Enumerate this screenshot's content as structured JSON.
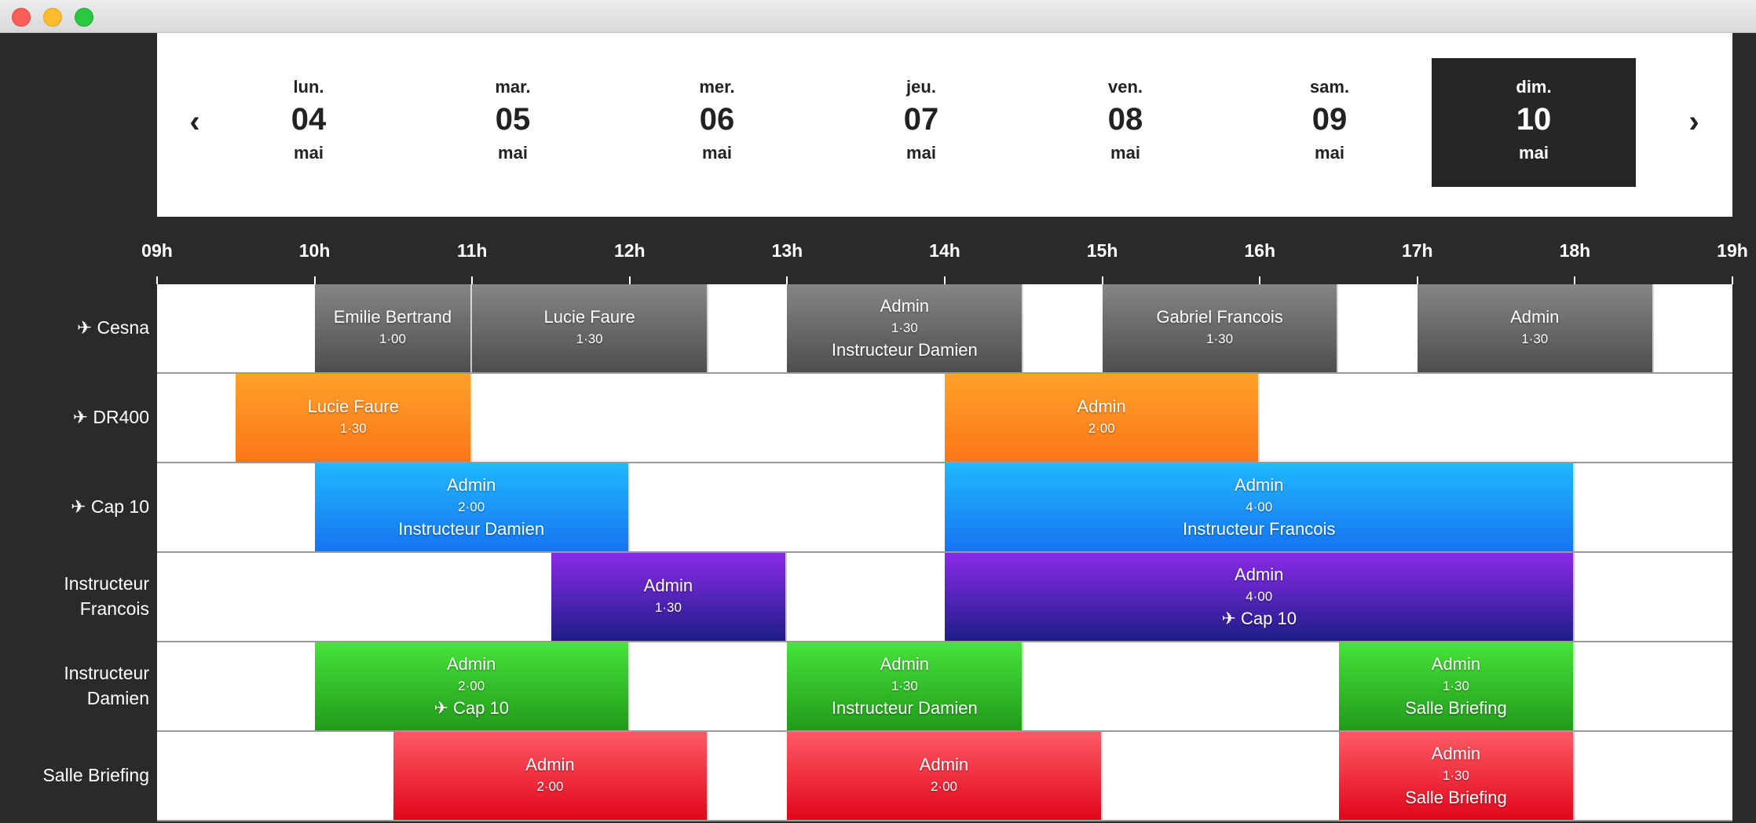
{
  "nav": {
    "prev_icon": "‹",
    "next_icon": "›"
  },
  "days": [
    {
      "name": "lun.",
      "num": "04",
      "month": "mai",
      "selected": false
    },
    {
      "name": "mar.",
      "num": "05",
      "month": "mai",
      "selected": false
    },
    {
      "name": "mer.",
      "num": "06",
      "month": "mai",
      "selected": false
    },
    {
      "name": "jeu.",
      "num": "07",
      "month": "mai",
      "selected": false
    },
    {
      "name": "ven.",
      "num": "08",
      "month": "mai",
      "selected": false
    },
    {
      "name": "sam.",
      "num": "09",
      "month": "mai",
      "selected": false
    },
    {
      "name": "dim.",
      "num": "10",
      "month": "mai",
      "selected": true
    }
  ],
  "hours": [
    "09h",
    "10h",
    "11h",
    "12h",
    "13h",
    "14h",
    "15h",
    "16h",
    "17h",
    "18h",
    "19h"
  ],
  "resources": [
    {
      "label": "✈ Cesna"
    },
    {
      "label": "✈ DR400"
    },
    {
      "label": "✈ Cap 10"
    },
    {
      "label": "Instructeur\nFrancois"
    },
    {
      "label": "Instructeur\nDamien"
    },
    {
      "label": "Salle Briefing"
    }
  ],
  "colors": {
    "gray": "#6b6b6b",
    "orange": "#fd8a20",
    "blue": "#1a98f6",
    "purple": "#5a24b8",
    "green": "#33c02a",
    "red": "#f0303f"
  },
  "events": [
    {
      "row": 0,
      "start": 10.0,
      "end": 11.0,
      "color": "gray",
      "title": "Emilie Bertrand",
      "duration": "1·00",
      "sub": ""
    },
    {
      "row": 0,
      "start": 11.0,
      "end": 12.5,
      "color": "gray",
      "title": "Lucie Faure",
      "duration": "1·30",
      "sub": ""
    },
    {
      "row": 0,
      "start": 13.0,
      "end": 14.5,
      "color": "gray",
      "title": "Admin",
      "duration": "1·30",
      "sub": "Instructeur Damien"
    },
    {
      "row": 0,
      "start": 15.0,
      "end": 16.5,
      "color": "gray",
      "title": "Gabriel Francois",
      "duration": "1·30",
      "sub": ""
    },
    {
      "row": 0,
      "start": 17.0,
      "end": 18.5,
      "color": "gray",
      "title": "Admin",
      "duration": "1·30",
      "sub": ""
    },
    {
      "row": 1,
      "start": 9.5,
      "end": 11.0,
      "color": "orange",
      "title": "Lucie Faure",
      "duration": "1·30",
      "sub": ""
    },
    {
      "row": 1,
      "start": 14.0,
      "end": 16.0,
      "color": "orange",
      "title": "Admin",
      "duration": "2·00",
      "sub": ""
    },
    {
      "row": 2,
      "start": 10.0,
      "end": 12.0,
      "color": "blue",
      "title": "Admin",
      "duration": "2·00",
      "sub": "Instructeur Damien"
    },
    {
      "row": 2,
      "start": 14.0,
      "end": 18.0,
      "color": "blue",
      "title": "Admin",
      "duration": "4·00",
      "sub": "Instructeur Francois"
    },
    {
      "row": 3,
      "start": 11.5,
      "end": 13.0,
      "color": "purple",
      "title": "Admin",
      "duration": "1·30",
      "sub": ""
    },
    {
      "row": 3,
      "start": 14.0,
      "end": 18.0,
      "color": "purple",
      "title": "Admin",
      "duration": "4·00",
      "sub": "✈ Cap 10"
    },
    {
      "row": 4,
      "start": 10.0,
      "end": 12.0,
      "color": "green",
      "title": "Admin",
      "duration": "2·00",
      "sub": "✈ Cap 10"
    },
    {
      "row": 4,
      "start": 13.0,
      "end": 14.5,
      "color": "green",
      "title": "Admin",
      "duration": "1·30",
      "sub": "Instructeur Damien"
    },
    {
      "row": 4,
      "start": 16.5,
      "end": 18.0,
      "color": "green",
      "title": "Admin",
      "duration": "1·30",
      "sub": "Salle Briefing"
    },
    {
      "row": 5,
      "start": 10.5,
      "end": 12.5,
      "color": "red",
      "title": "Admin",
      "duration": "2·00",
      "sub": ""
    },
    {
      "row": 5,
      "start": 13.0,
      "end": 15.0,
      "color": "red",
      "title": "Admin",
      "duration": "2·00",
      "sub": ""
    },
    {
      "row": 5,
      "start": 16.5,
      "end": 18.0,
      "color": "red",
      "title": "Admin",
      "duration": "1·30",
      "sub": "Salle Briefing"
    }
  ]
}
